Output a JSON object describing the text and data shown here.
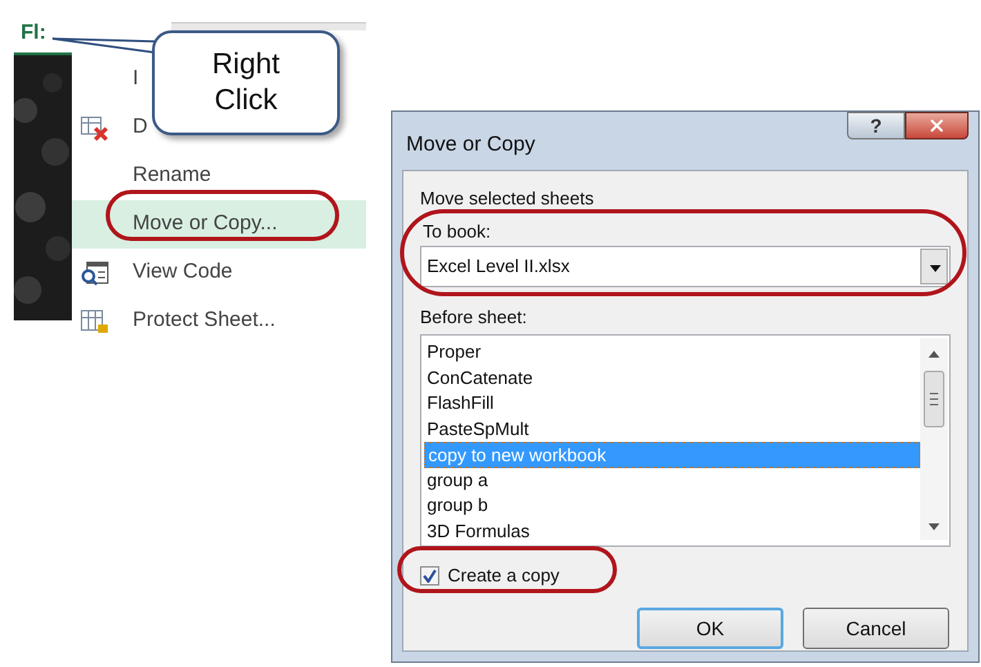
{
  "context_menu": {
    "sheet_tab": "Fl:",
    "items": [
      {
        "label": "I",
        "kind": "none",
        "selected": false
      },
      {
        "label": "D",
        "kind": "delete",
        "selected": false
      },
      {
        "label": "Rename",
        "kind": "none",
        "selected": false
      },
      {
        "label": "Move or Copy...",
        "kind": "none",
        "selected": true
      },
      {
        "label": "View Code",
        "kind": "code",
        "selected": false
      },
      {
        "label": "Protect Sheet...",
        "kind": "protect",
        "selected": false
      }
    ]
  },
  "callout": {
    "text": "Right Click"
  },
  "dialog": {
    "title": "Move or Copy",
    "help_button": "?",
    "group_label": "Move selected sheets",
    "to_book_label": "To book:",
    "to_book_value": "Excel Level II.xlsx",
    "before_sheet_label": "Before sheet:",
    "sheets": [
      {
        "label": "Proper",
        "selected": false
      },
      {
        "label": "ConCatenate",
        "selected": false
      },
      {
        "label": "FlashFill",
        "selected": false
      },
      {
        "label": "PasteSpMult",
        "selected": false
      },
      {
        "label": "copy to new workbook",
        "selected": true
      },
      {
        "label": "group a",
        "selected": false
      },
      {
        "label": "group b",
        "selected": false
      },
      {
        "label": "3D Formulas",
        "selected": false
      }
    ],
    "create_copy": {
      "label": "Create a copy",
      "checked": true
    },
    "buttons": [
      "OK",
      "Cancel"
    ]
  }
}
